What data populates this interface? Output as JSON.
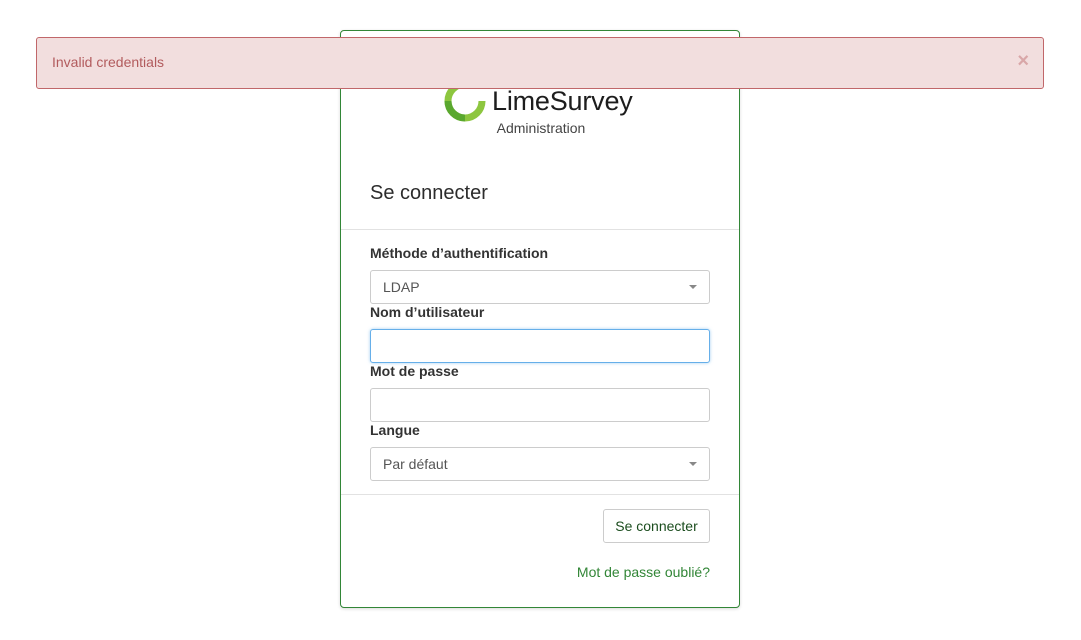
{
  "alert": {
    "message": "Invalid credentials",
    "close_glyph": "×"
  },
  "brand": {
    "logo_icon": "limesurvey-logo-icon",
    "name": "LimeSurvey",
    "subtitle": "Administration",
    "accent_color": "#328637"
  },
  "login": {
    "title": "Se connecter",
    "auth_method": {
      "label": "Méthode d’authentification",
      "value": "LDAP"
    },
    "username": {
      "label": "Nom d’utilisateur",
      "value": ""
    },
    "password": {
      "label": "Mot de passe",
      "value": ""
    },
    "language": {
      "label": "Langue",
      "value": "Par défaut"
    },
    "submit_label": "Se connecter",
    "forgot_password": "Mot de passe oublié?"
  }
}
